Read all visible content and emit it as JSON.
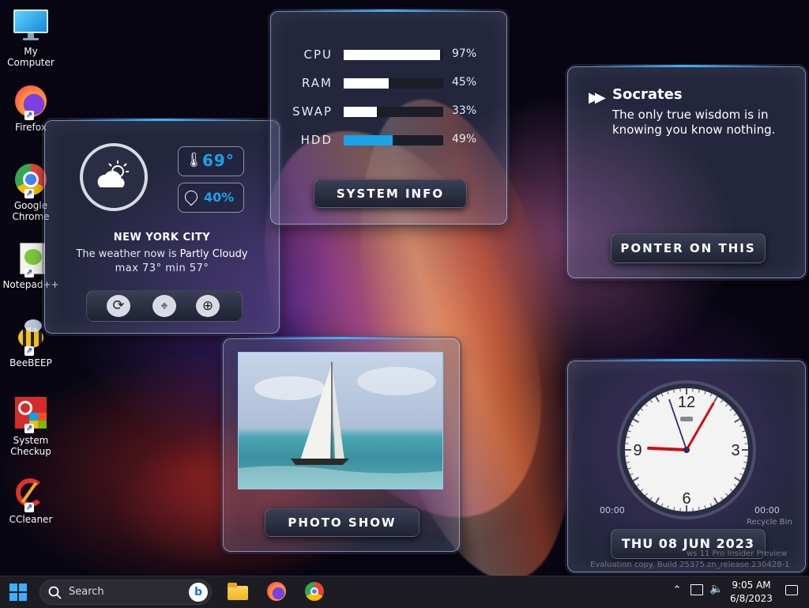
{
  "desktop_icons": [
    {
      "label": "My Computer",
      "icon": "monitor-icon"
    },
    {
      "label": "Firefox",
      "icon": "firefox-icon"
    },
    {
      "label": "Google Chrome",
      "icon": "chrome-icon"
    },
    {
      "label": "Notepad++",
      "icon": "notepad-plus-plus-icon"
    },
    {
      "label": "BeeBEEP",
      "icon": "bee-icon"
    },
    {
      "label": "System Checkup",
      "icon": "system-checkup-icon"
    },
    {
      "label": "CCleaner",
      "icon": "ccleaner-icon"
    }
  ],
  "weather": {
    "temperature": "69°",
    "humidity": "40%",
    "city": "NEW YORK CITY",
    "desc_prefix": "The weather now is ",
    "condition": "Partly Cloudy",
    "range": "max 73° min 57°",
    "buttons": [
      "refresh-icon",
      "location-icon",
      "globe-icon"
    ]
  },
  "system_info": {
    "rows": [
      {
        "label": "CPU",
        "pct": "97%",
        "value": 0.97,
        "color": "#ffffff"
      },
      {
        "label": "RAM",
        "pct": "45%",
        "value": 0.45,
        "color": "#ffffff"
      },
      {
        "label": "SWAP",
        "pct": "33%",
        "value": 0.33,
        "color": "#ffffff"
      },
      {
        "label": "HDD",
        "pct": "49%",
        "value": 0.49,
        "color": "#1aa3e8"
      }
    ],
    "button": "SYSTEM INFO"
  },
  "quote": {
    "author": "Socrates",
    "text": "The only true wisdom is in knowing you know nothing.",
    "button": "PONTER ON THIS"
  },
  "photo": {
    "button": "PHOTO SHOW"
  },
  "clock": {
    "numbers": [
      "12",
      "3",
      "6",
      "9"
    ],
    "left_time": "00:00",
    "right_time": "00:00",
    "date": "THU 08 JUN 2023",
    "hour": 9,
    "minute": 5
  },
  "desktop_overlay": {
    "recycle": "Recycle Bin",
    "watermark1": "ws 11 Pro Insider Preview",
    "watermark2": "Evaluation copy. Build 25375.zn_release.230428-1"
  },
  "taskbar": {
    "search_placeholder": "Search",
    "time": "9:05 AM",
    "date": "6/8/2023",
    "apps": [
      "file-explorer-icon",
      "firefox-icon",
      "chrome-icon"
    ]
  }
}
